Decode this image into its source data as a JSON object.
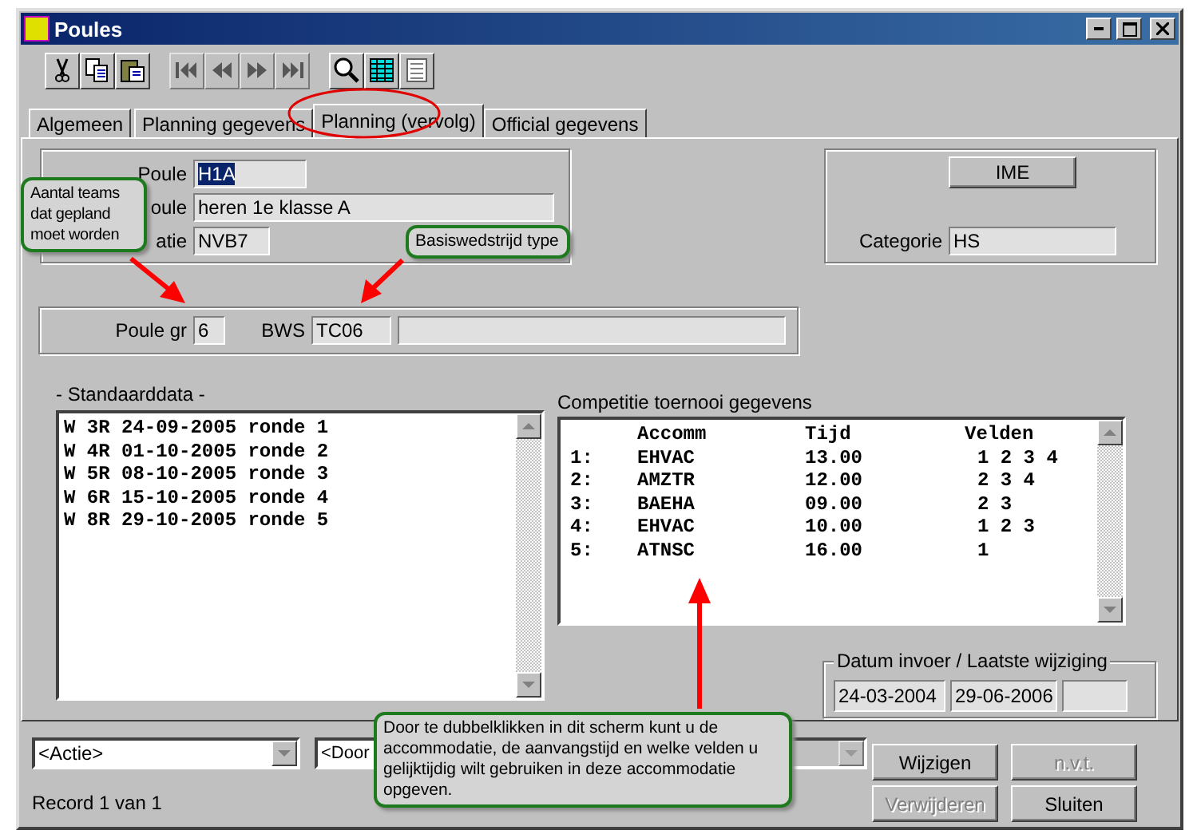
{
  "window": {
    "title": "Poules"
  },
  "toolbar": [
    [
      {
        "kind": "cut",
        "disabled": false
      },
      {
        "kind": "copy",
        "disabled": false
      },
      {
        "kind": "paste",
        "disabled": false
      }
    ],
    [
      {
        "kind": "first",
        "disabled": true
      },
      {
        "kind": "prev",
        "disabled": true
      },
      {
        "kind": "next",
        "disabled": true
      },
      {
        "kind": "last",
        "disabled": true
      }
    ],
    [
      {
        "kind": "search",
        "disabled": false
      },
      {
        "kind": "grid",
        "disabled": false
      },
      {
        "kind": "form",
        "disabled": false
      }
    ]
  ],
  "tabs": [
    {
      "label": "Algemeen",
      "selected": false,
      "circled": false
    },
    {
      "label": "Planning gegevens",
      "selected": false,
      "circled": false
    },
    {
      "label": "Planning (vervolg)",
      "selected": true,
      "circled": true
    },
    {
      "label": "Official gegevens",
      "selected": false,
      "circled": false
    }
  ],
  "poule_group": [
    {
      "label": "Poule",
      "value": "H1A",
      "text_selected": true
    },
    {
      "label": "oule",
      "value": "heren 1e klasse A",
      "text_selected": false
    },
    {
      "label": "atie",
      "value": "NVB7",
      "text_selected": false
    }
  ],
  "category_group": {
    "button": "IME",
    "label": "Categorie",
    "value": "HS"
  },
  "size_group": {
    "poule_label": "Poule gr",
    "poule_value": "6",
    "bws_label": "BWS",
    "bws_value": "TC06"
  },
  "standaarddata": {
    "title": "- Standaarddata -",
    "lines": [
      "W 3R 24-09-2005 ronde 1",
      "W 4R 01-10-2005 ronde 2",
      "W 5R 08-10-2005 ronde 3",
      "W 6R 15-10-2005 ronde 4",
      "W 8R 29-10-2005 ronde 5"
    ]
  },
  "competitie": {
    "title": "Competitie toernooi gegevens",
    "columns": [
      "Accomm",
      "Tijd",
      "Velden"
    ],
    "rows": [
      {
        "nr": "1:",
        "accomm": "EHVAC",
        "tijd": "13.00",
        "velden": "1 2 3 4"
      },
      {
        "nr": "2:",
        "accomm": "AMZTR",
        "tijd": "12.00",
        "velden": "2 3 4"
      },
      {
        "nr": "3:",
        "accomm": "BAEHA",
        "tijd": "09.00",
        "velden": "2 3"
      },
      {
        "nr": "4:",
        "accomm": "EHVAC",
        "tijd": "10.00",
        "velden": "1 2 3"
      },
      {
        "nr": "5:",
        "accomm": "ATNSC",
        "tijd": "16.00",
        "velden": "1"
      }
    ]
  },
  "datum_group": {
    "title": "Datum invoer / Laatste wijziging",
    "values": [
      "24-03-2004",
      "29-06-2006"
    ]
  },
  "dropdowns": [
    {
      "value": "<Actie>",
      "disabled": false
    },
    {
      "value": "<Door",
      "disabled": false
    },
    {
      "disabled": true
    }
  ],
  "buttons": [
    {
      "label": "Wijzigen",
      "disabled": false
    },
    {
      "label": "n.v.t.",
      "disabled": true
    },
    {
      "label": "Verwijderen",
      "disabled": true
    },
    {
      "label": "Sluiten",
      "disabled": false
    }
  ],
  "record": "Record 1 van 1",
  "callouts": [
    {
      "kind": "teams",
      "text": "Aantal teams dat gepland moet worden"
    },
    {
      "kind": "bws",
      "text": "Basiswedstrijd type"
    },
    {
      "kind": "list",
      "text": "Door te dubbelklikken in dit scherm kunt u de accommodatie, de aanvangstijd en  welke velden u gelijktijdig wilt gebruiken in deze accommodatie opgeven."
    }
  ]
}
